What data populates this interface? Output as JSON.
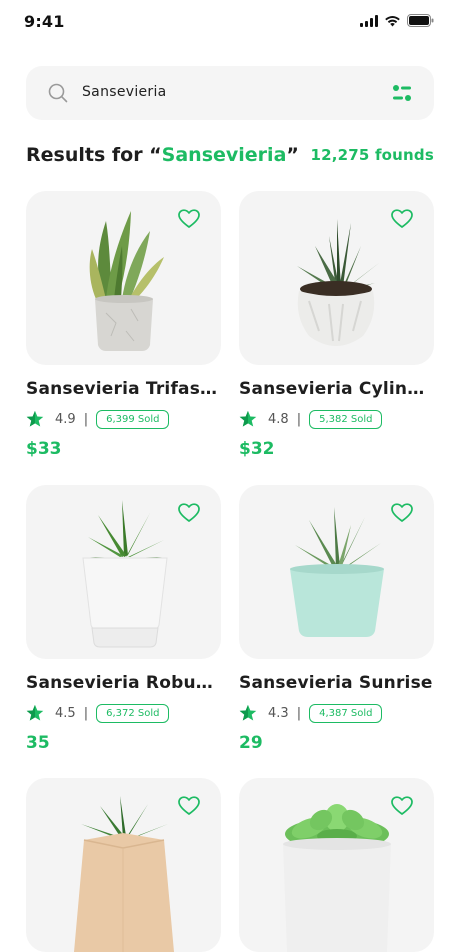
{
  "status_bar": {
    "time": "9:41"
  },
  "search": {
    "query": "Sansevieria"
  },
  "results": {
    "prefix": "Results for “",
    "query": "Sansevieria",
    "suffix": "”",
    "count": "12,275 founds"
  },
  "colors": {
    "accent": "#1dbb63",
    "card_bg": "#f4f4f4",
    "text": "#1e1e1e"
  },
  "products": [
    {
      "name": "Sansevieria Trifasci...",
      "rating": "4.9",
      "separator": "|",
      "sold": "6,399 Sold",
      "price": "$33"
    },
    {
      "name": "Sansevieria Cylindr..",
      "rating": "4.8",
      "separator": "|",
      "sold": "5,382 Sold",
      "price": "$32"
    },
    {
      "name": "Sansevieria Robusta",
      "rating": "4.5",
      "separator": "|",
      "sold": "6,372 Sold",
      "price": "35"
    },
    {
      "name": "Sansevieria Sunrise",
      "rating": "4.3",
      "separator": "|",
      "sold": "4,387 Sold",
      "price": "29"
    },
    {
      "name": "",
      "rating": "",
      "separator": "",
      "sold": "",
      "price": ""
    },
    {
      "name": "",
      "rating": "",
      "separator": "",
      "sold": "",
      "price": ""
    }
  ]
}
